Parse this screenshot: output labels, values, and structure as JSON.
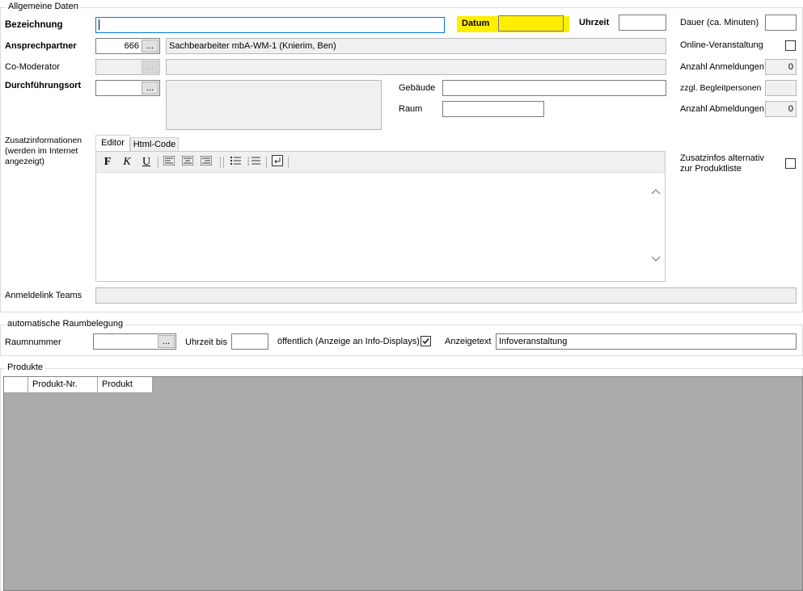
{
  "general": {
    "group_title": "Allgemeine Daten",
    "bezeichnung_label": "Bezeichnung",
    "bezeichnung_value": "",
    "datum_label": "Datum",
    "datum_value": "",
    "uhrzeit_label": "Uhrzeit",
    "uhrzeit_value": "",
    "dauer_label": "Dauer (ca. Minuten)",
    "dauer_value": "",
    "ansprechpartner_label": "Ansprechpartner",
    "ansprechpartner_id": "666",
    "ansprechpartner_name": "Sachbearbeiter mbA-WM-1 (Knierim, Ben)",
    "online_label": "Online-Veranstaltung",
    "online_checked": false,
    "comoderator_label": "Co-Moderator",
    "anmeldungen_label": "Anzahl Anmeldungen",
    "anmeldungen_value": "0",
    "durchfuehrungsort_label": "Durchführungsort",
    "gebaeude_label": "Gebäude",
    "raum_label": "Raum",
    "begleitpersonen_label": "zzgl. Begleitpersonen",
    "begleitpersonen_value": "",
    "abmeldungen_label": "Anzahl Abmeldungen",
    "abmeldungen_value": "0",
    "zusatz_label": "Zusatzinformationen (werden im Internet angezeigt)",
    "zusatz_alt_label": "Zusatzinfos alternativ zur Produktliste",
    "anmeldelink_label": "Anmeldelink Teams",
    "browse_button": "...",
    "editor": {
      "tab_editor": "Editor",
      "tab_html": "Html-Code",
      "bold": "F",
      "italic": "K",
      "underline": "U"
    }
  },
  "raum": {
    "group_title": "automatische Raumbelegung",
    "raumnummer_label": "Raumnummer",
    "uhrzeit_bis_label": "Uhrzeit bis",
    "oeffentlich_label": "öffentlich (Anzeige an Info-Displays)",
    "oeffentlich_checked": true,
    "anzeigetext_label": "Anzeigetext",
    "anzeigetext_value": "Infoveranstaltung"
  },
  "produkte": {
    "group_title": "Produkte",
    "columns": [
      "Produkt-Nr.",
      "Produkt"
    ]
  },
  "colors": {
    "highlight": "#ffee00",
    "grid_bg": "#ababab"
  }
}
